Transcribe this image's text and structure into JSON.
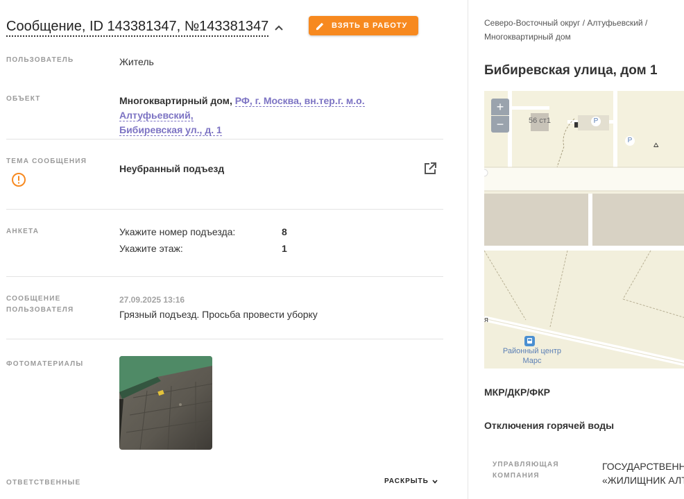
{
  "header": {
    "title": "Сообщение, ID 143381347, №143381347",
    "take_button": "ВЗЯТЬ В РАБОТУ"
  },
  "fields": {
    "user_label": "ПОЛЬЗОВАТЕЛЬ",
    "user_value": "Житель",
    "object_label": "ОБЪЕКТ",
    "object_type": "Многоквартирный дом,",
    "object_address_line1": "РФ, г. Москва, вн.тер.г. м.о. Алтуфьевский,",
    "object_address_line2": "Бибиревская ул., д. 1",
    "topic_label": "ТЕМА СООБЩЕНИЯ",
    "topic_value": "Неубранный подъезд",
    "survey_label": "АНКЕТА",
    "survey": [
      {
        "question": "Укажите номер подъезда:",
        "answer": "8"
      },
      {
        "question": "Укажите этаж:",
        "answer": "1"
      }
    ],
    "message_label_1": "СООБЩЕНИЕ",
    "message_label_2": "ПОЛЬЗОВАТЕЛЯ",
    "message_date": "27.09.2025 13:16",
    "message_text": "Грязный подъезд. Просьба провести уборку",
    "photos_label": "ФОТОМАТЕРИАЛЫ",
    "responsible_label": "ОТВЕТСТВЕННЫЕ",
    "expand_button": "РАСКРЫТЬ"
  },
  "right": {
    "breadcrumb_line1": "Северо-Восточный округ / Алтуфьевский /",
    "breadcrumb_line2": "Многоквартирный дом",
    "address": "Бибиревская улица, дом 1",
    "map": {
      "zoom_in": "+",
      "zoom_out": "−",
      "building_label": "56 ст1",
      "parking_1": "P",
      "parking_2": "P",
      "street_fragment": "я",
      "poi_line1": "Районный центр",
      "poi_line2": "Марс"
    },
    "section_mkr": "МКР/ДКР/ФКР",
    "section_hot_water": "Отключения горячей воды",
    "mgmt_label_1": "УПРАВЛЯЮЩАЯ",
    "mgmt_label_2": "КОМПАНИЯ",
    "mgmt_value_1": "ГОСУДАРСТВЕННОЕ",
    "mgmt_value_2": "«ЖИЛИЩНИК АЛТ"
  },
  "colors": {
    "accent": "#f7891f",
    "link": "#7c73c3",
    "warning": "#f7891f"
  },
  "icons": [
    "chevron-up-icon",
    "pencil-icon",
    "warning-icon",
    "external-link-icon",
    "chevron-down-icon",
    "bus-icon",
    "parking-icon"
  ]
}
